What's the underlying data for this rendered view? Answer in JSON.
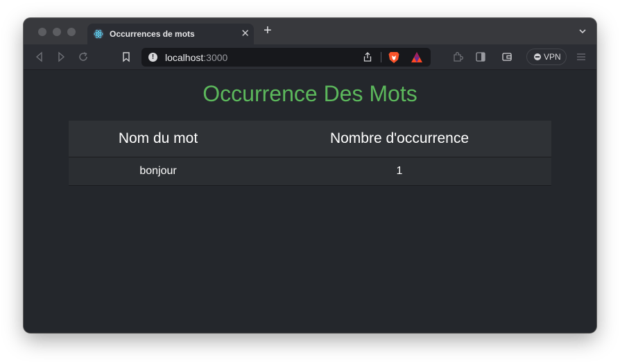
{
  "browser": {
    "tab": {
      "title": "Occurrences de mots"
    },
    "address": {
      "host": "localhost",
      "port": ":3000"
    },
    "vpn_label": "VPN"
  },
  "page": {
    "title": "Occurrence Des Mots",
    "table": {
      "headers": [
        "Nom du mot",
        "Nombre d'occurrence"
      ],
      "rows": [
        [
          "bonjour",
          "1"
        ]
      ]
    }
  },
  "colors": {
    "title": "#5cb85c",
    "page_background": "#24272c",
    "header_background": "#2f3236"
  },
  "icons": [
    "react-icon",
    "close-icon",
    "plus-icon",
    "chevron-down-icon",
    "back-icon",
    "forward-icon",
    "reload-icon",
    "bookmark-icon",
    "info-icon",
    "share-icon",
    "brave-shield-icon",
    "brave-rewards-icon",
    "extensions-icon",
    "sidebar-icon",
    "wallet-icon",
    "menu-icon"
  ]
}
